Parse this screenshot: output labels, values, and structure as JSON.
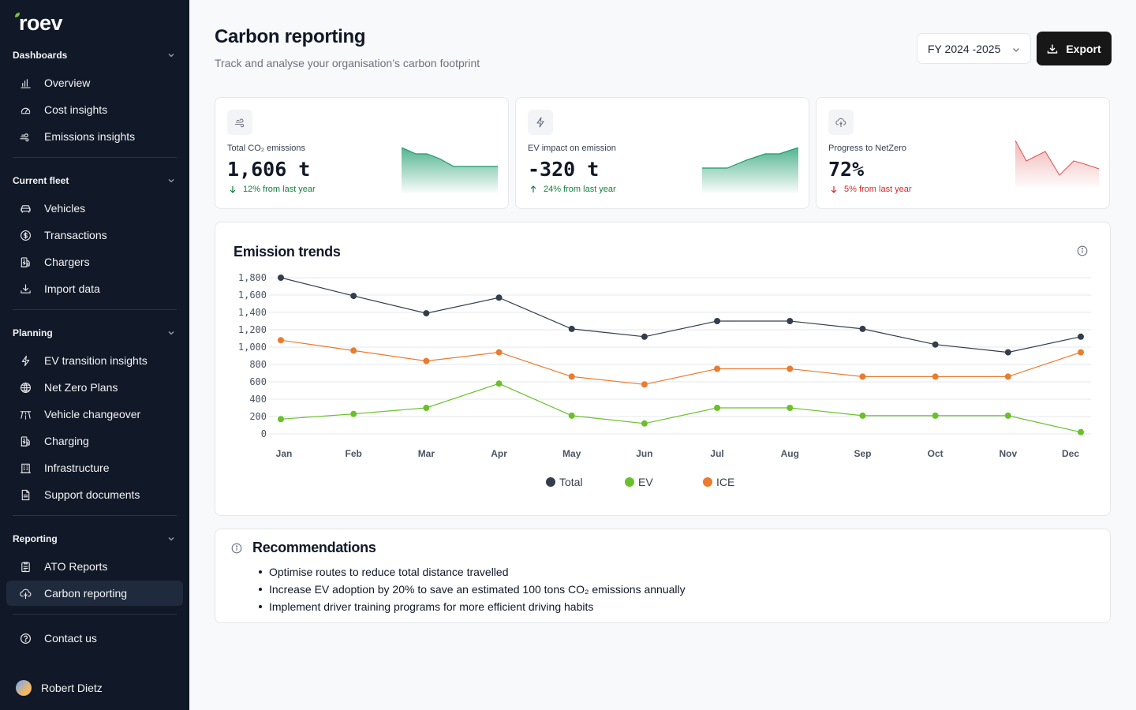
{
  "app": {
    "name": "roev"
  },
  "sidebar": {
    "sections": [
      {
        "title": "Dashboards",
        "items": [
          {
            "label": "Overview",
            "icon": "bar-chart-icon"
          },
          {
            "label": "Cost insights",
            "icon": "gauge-icon"
          },
          {
            "label": "Emissions insights",
            "icon": "emissions-icon"
          }
        ]
      },
      {
        "title": "Current fleet",
        "items": [
          {
            "label": "Vehicles",
            "icon": "car-icon"
          },
          {
            "label": "Transactions",
            "icon": "dollar-circle-icon"
          },
          {
            "label": "Chargers",
            "icon": "fuel-pump-icon"
          },
          {
            "label": "Import data",
            "icon": "download-icon"
          }
        ]
      },
      {
        "title": "Planning",
        "items": [
          {
            "label": "EV transition insights",
            "icon": "lightning-icon"
          },
          {
            "label": "Net Zero Plans",
            "icon": "globe-icon"
          },
          {
            "label": "Vehicle changeover",
            "icon": "road-icon"
          },
          {
            "label": "Charging",
            "icon": "fuel-pump-icon"
          },
          {
            "label": "Infrastructure",
            "icon": "building-icon"
          },
          {
            "label": "Support documents",
            "icon": "document-icon"
          }
        ]
      },
      {
        "title": "Reporting",
        "items": [
          {
            "label": "ATO Reports",
            "icon": "clipboard-icon"
          },
          {
            "label": "Carbon reporting",
            "icon": "cloud-tree-icon",
            "active": true
          }
        ]
      }
    ],
    "contact": {
      "label": "Contact us",
      "icon": "help-circle-icon"
    },
    "user": {
      "name": "Robert Dietz"
    }
  },
  "header": {
    "title": "Carbon reporting",
    "subtitle": "Track and analyse your organisation’s carbon footprint",
    "fiscal_year": "FY 2024 -2025",
    "export_label": "Export"
  },
  "kpis": [
    {
      "label": "Total CO₂ emissions",
      "value": "1,606 t",
      "delta": "12% from last year",
      "direction": "down",
      "sentiment": "good",
      "color": "#1a9b6c",
      "icon": "emissions-icon"
    },
    {
      "label": "EV impact on emission",
      "value": "-320 t",
      "delta": "24% from last year",
      "direction": "up",
      "sentiment": "good",
      "color": "#1a9b6c",
      "icon": "lightning-icon"
    },
    {
      "label": "Progress to NetZero",
      "value": "72%",
      "delta": "5% from last year",
      "direction": "down",
      "sentiment": "bad",
      "color": "#e05a5a",
      "icon": "cloud-tree-icon"
    }
  ],
  "recommendations": {
    "title": "Recommendations",
    "items": [
      "Optimise routes to reduce total distance travelled",
      "Increase EV adoption by 20% to save an estimated 100 tons CO₂ emissions annually",
      "Implement driver training programs for more efficient driving habits"
    ]
  },
  "chart_data": {
    "type": "line",
    "title": "Emission trends",
    "categories": [
      "Jan",
      "Feb",
      "Mar",
      "Apr",
      "May",
      "Jun",
      "Jul",
      "Aug",
      "Sep",
      "Oct",
      "Nov",
      "Dec"
    ],
    "ylim": [
      0,
      1800
    ],
    "yticks": [
      0,
      200,
      400,
      600,
      800,
      1000,
      1200,
      1400,
      1600,
      1800
    ],
    "ytick_labels": [
      "0",
      "200",
      "400",
      "600",
      "800",
      "1,000",
      "1,200",
      "1,400",
      "1,600",
      "1,800"
    ],
    "grid": true,
    "legend_position": "bottom",
    "series": [
      {
        "name": "Total",
        "color": "#333d4d",
        "values": [
          1800,
          1590,
          1390,
          1570,
          1210,
          1120,
          1300,
          1300,
          1210,
          1030,
          940,
          1120
        ]
      },
      {
        "name": "EV",
        "color": "#6ac02b",
        "values": [
          170,
          230,
          300,
          580,
          210,
          120,
          300,
          300,
          210,
          210,
          210,
          20
        ]
      },
      {
        "name": "ICE",
        "color": "#ea7b2f",
        "values": [
          1080,
          960,
          840,
          940,
          660,
          570,
          750,
          750,
          660,
          660,
          660,
          940
        ]
      }
    ]
  }
}
